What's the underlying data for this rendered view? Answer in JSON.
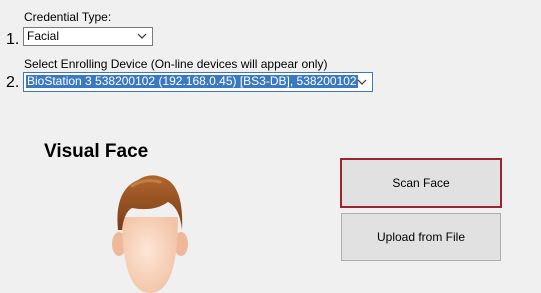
{
  "form": {
    "credential_type_label": "Credential Type:",
    "step1": "1.",
    "credential_type_value": "Facial",
    "device_label": "Select Enrolling Device (On-line devices will appear only)",
    "step2": "2.",
    "device_value": "BioStation 3 538200102 (192.168.0.45)  [BS3-DB], 538200102"
  },
  "visual_face": {
    "heading": "Visual Face"
  },
  "buttons": {
    "scan_face": "Scan Face",
    "upload_from_file": "Upload from File"
  },
  "colors": {
    "accent_border": "#9b2335",
    "selection": "#3b78c2",
    "background": "#f0f0f0"
  }
}
